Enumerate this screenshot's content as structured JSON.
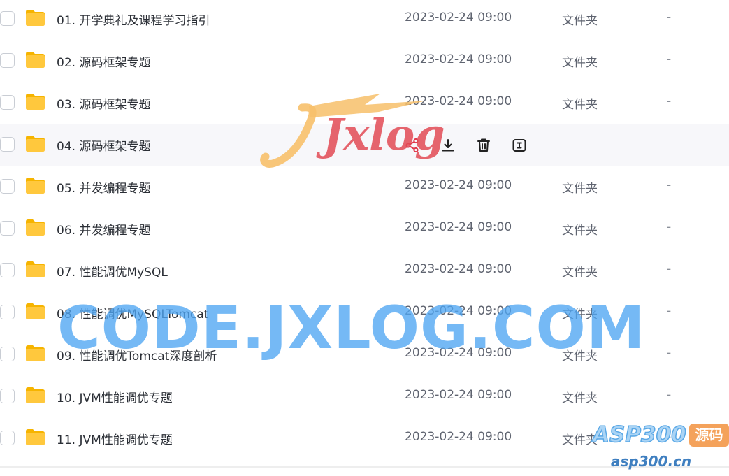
{
  "files": [
    {
      "name": "01. 开学典礼及课程学习指引",
      "date": "2023-02-24 09:00",
      "type": "文件夹",
      "size": "-"
    },
    {
      "name": "02. 源码框架专题",
      "date": "2023-02-24 09:00",
      "type": "文件夹",
      "size": "-"
    },
    {
      "name": "03. 源码框架专题",
      "date": "2023-02-24 09:00",
      "type": "文件夹",
      "size": "-"
    },
    {
      "name": "04. 源码框架专题",
      "date": "",
      "type": "",
      "size": "",
      "hovered": true
    },
    {
      "name": "05. 并发编程专题",
      "date": "2023-02-24 09:00",
      "type": "文件夹",
      "size": "-"
    },
    {
      "name": "06. 并发编程专题",
      "date": "2023-02-24 09:00",
      "type": "文件夹",
      "size": "-"
    },
    {
      "name": "07. 性能调优MySQL",
      "date": "2023-02-24 09:00",
      "type": "文件夹",
      "size": "-"
    },
    {
      "name": "08. 性能调优MySQLTomcat",
      "date": "2023-02-24 09:00",
      "type": "文件夹",
      "size": "-"
    },
    {
      "name": "09. 性能调优Tomcat深度剖析",
      "date": "2023-02-24 09:00",
      "type": "文件夹",
      "size": "-"
    },
    {
      "name": "10. JVM性能调优专题",
      "date": "2023-02-24 09:00",
      "type": "文件夹",
      "size": "-"
    },
    {
      "name": "11. JVM性能调优专题",
      "date": "2023-02-24 09:00",
      "type": "文件夹",
      "size": "-"
    }
  ],
  "row_actions": [
    {
      "icon": "share-icon"
    },
    {
      "icon": "download-icon"
    },
    {
      "icon": "trash-icon"
    },
    {
      "icon": "rename-icon"
    }
  ],
  "colors": {
    "folder": "#ffc83d",
    "folder_back": "#f6b400",
    "action_share": "#e0384b",
    "action_default": "#222222",
    "hover_row": "#f7f7fa"
  },
  "watermarks": {
    "jxlog": "Jxlog",
    "code": "CODE.JXLOG.COM",
    "asp_main": "ASP300",
    "asp_badge": "源码",
    "asp_sub": "asp300.cn"
  }
}
